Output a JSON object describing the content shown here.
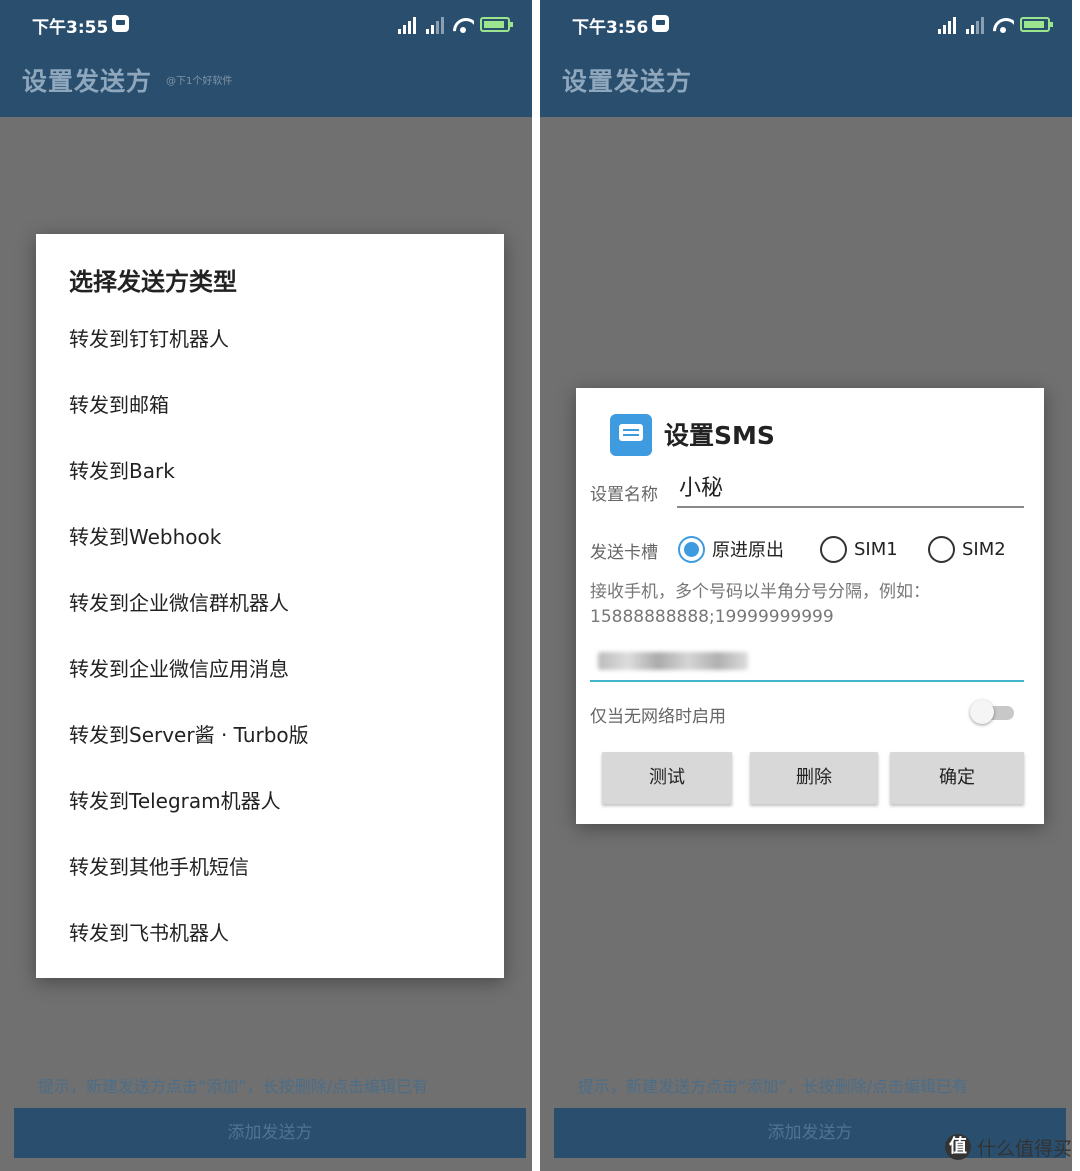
{
  "left": {
    "status_time": "下午3:55",
    "app_title": "设置发送方",
    "watermark": "@下1个好软件",
    "dialog_title": "选择发送方类型",
    "sender_types": [
      "转发到钉钉机器人",
      "转发到邮箱",
      "转发到Bark",
      "转发到Webhook",
      "转发到企业微信群机器人",
      "转发到企业微信应用消息",
      "转发到Server酱 · Turbo版",
      "转发到Telegram机器人",
      "转发到其他手机短信",
      "转发到飞书机器人"
    ],
    "hint": "提示，新建发送方点击“添加”，长按删除/点击编辑已有",
    "add_button": "添加发送方"
  },
  "right": {
    "status_time": "下午3:56",
    "app_title": "设置发送方",
    "dialog_title": "设置SMS",
    "name_label": "设置名称",
    "name_value": "小秘",
    "sim_label": "发送卡槽",
    "sim_options": [
      "原进原出",
      "SIM1",
      "SIM2"
    ],
    "sim_selected": "原进原出",
    "phone_hint": "接收手机，多个号码以半角分号分隔，例如：15888888888;19999999999",
    "offline_label": "仅当无网络时启用",
    "offline_enabled": false,
    "buttons": {
      "test": "测试",
      "delete": "删除",
      "confirm": "确定"
    },
    "hint": "提示，新建发送方点击“添加”，长按删除/点击编辑已有",
    "add_button": "添加发送方"
  },
  "logo": {
    "mark": "值",
    "text": "什么值得买"
  },
  "colors": {
    "appbar": "#2a4f6e",
    "accent": "#3e9be0",
    "overlay": "#707070",
    "input_focus": "#3fb6c9"
  }
}
